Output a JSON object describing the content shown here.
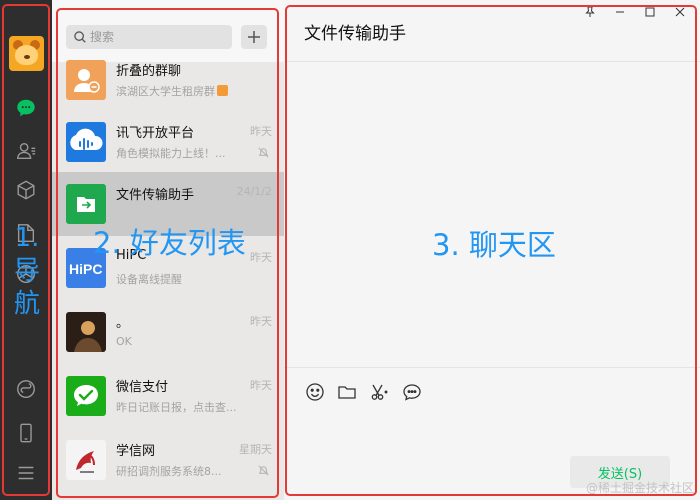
{
  "nav": {
    "icons": [
      "chat-icon",
      "contacts-icon",
      "favorites-icon",
      "files-icon",
      "moments-icon",
      "mini-program-icon",
      "phone-icon",
      "menu-icon"
    ],
    "active_color": "#07c160"
  },
  "search": {
    "placeholder": "搜索",
    "add_label": "+"
  },
  "chats": [
    {
      "name": "折叠的群聊",
      "time": "",
      "preview": "滨湖区大学生租房群",
      "avatar": "folded-group-avatar",
      "muted": false
    },
    {
      "name": "讯飞开放平台",
      "time": "昨天",
      "preview": "角色模拟能力上线！...",
      "avatar": "iflytek-avatar",
      "muted": true
    },
    {
      "name": "文件传输助手",
      "time": "24/1/2",
      "preview": "",
      "avatar": "file-transfer-avatar",
      "muted": false,
      "active": true
    },
    {
      "name": "HiPC",
      "time": "昨天",
      "preview": "设备离线提醒",
      "avatar": "hipc-avatar",
      "muted": false
    },
    {
      "name": "。",
      "time": "昨天",
      "preview": "OK",
      "avatar": "person-avatar",
      "muted": false
    },
    {
      "name": "微信支付",
      "time": "昨天",
      "preview": "昨日记账日报，点击查...",
      "avatar": "wechat-pay-avatar",
      "muted": false
    },
    {
      "name": "学信网",
      "time": "星期天",
      "preview": "研招调剂服务系统8...",
      "avatar": "chsi-avatar",
      "muted": true
    }
  ],
  "chat": {
    "title": "文件传输助手",
    "send_label": "发送(S)",
    "tools": [
      "emoji-icon",
      "folder-icon",
      "scissors-icon",
      "chat-bubble-icon"
    ]
  },
  "annotations": {
    "nav_label_chars": [
      "1.",
      "导",
      "航"
    ],
    "list_label": "2. 好友列表",
    "chat_label": "3. 聊天区",
    "color_box": "#e53935",
    "color_text": "#2196f3"
  },
  "watermark": "@稀土掘金技术社区",
  "colors": {
    "nav_bg": "#2e2e2e",
    "list_bg": "#eae8e7",
    "active_item": "#c9c9c9",
    "accent": "#07c160"
  }
}
